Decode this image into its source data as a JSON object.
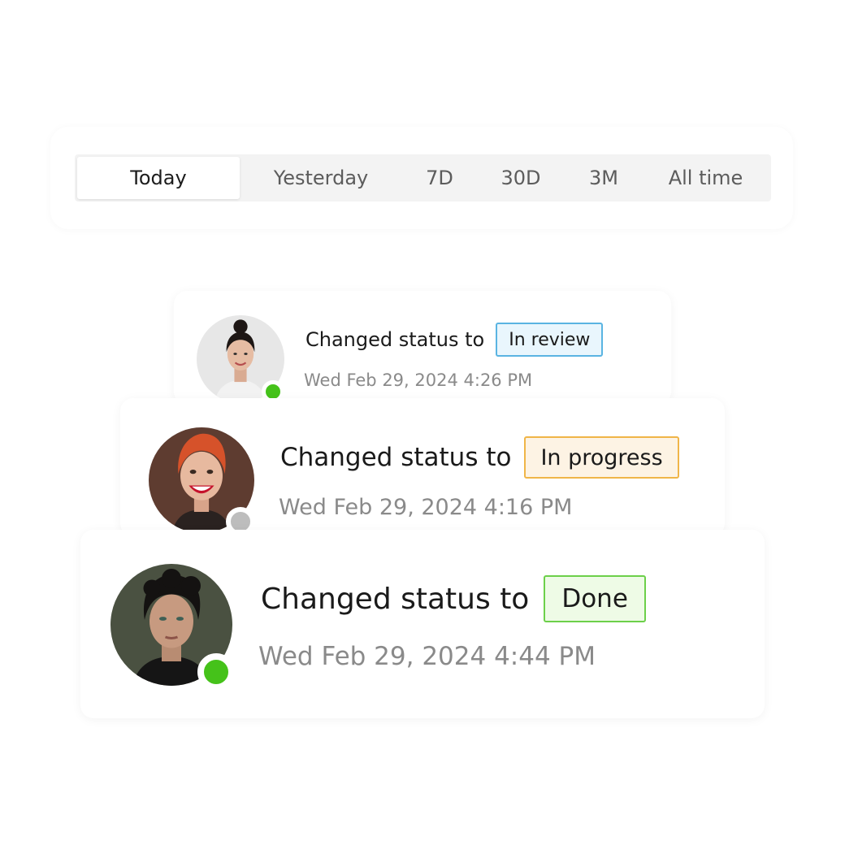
{
  "filters": {
    "tabs": [
      {
        "label": "Today",
        "active": true
      },
      {
        "label": "Yesterday",
        "active": false
      },
      {
        "label": "7D",
        "active": false
      },
      {
        "label": "30D",
        "active": false
      },
      {
        "label": "3M",
        "active": false
      },
      {
        "label": "All time",
        "active": false
      }
    ]
  },
  "activity": [
    {
      "message": "Changed status to",
      "status": "In review",
      "status_colors": {
        "background": "#e9f6fd",
        "border": "#5ab4e2"
      },
      "timestamp": "Wed Feb 29, 2024 4:26 PM",
      "presence": "online",
      "presence_color": "#45c21a"
    },
    {
      "message": "Changed status to",
      "status": "In progress",
      "status_colors": {
        "background": "#fdf3e4",
        "border": "#f0b548"
      },
      "timestamp": "Wed Feb 29, 2024 4:16 PM",
      "presence": "offline",
      "presence_color": "#bdbdbd"
    },
    {
      "message": "Changed status to",
      "status": "Done",
      "status_colors": {
        "background": "#eefbe6",
        "border": "#6cd04a"
      },
      "timestamp": "Wed Feb 29, 2024 4:44 PM",
      "presence": "online",
      "presence_color": "#45c21a"
    }
  ]
}
